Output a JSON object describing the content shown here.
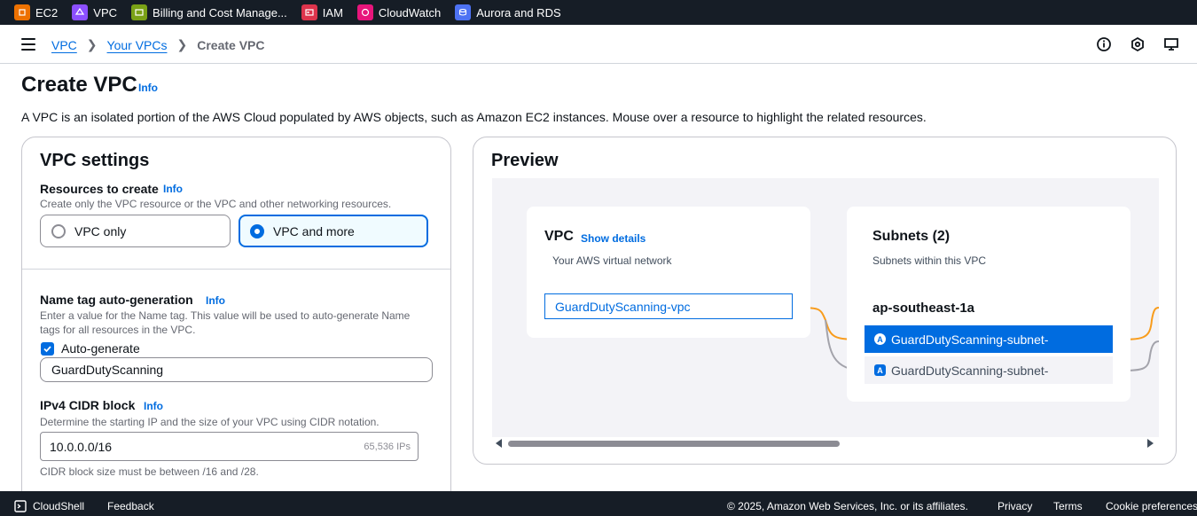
{
  "favorites": [
    {
      "label": "EC2",
      "color": "#ed7100"
    },
    {
      "label": "VPC",
      "color": "#8c4fff"
    },
    {
      "label": "Billing and Cost Manage...",
      "color": "#7aa116"
    },
    {
      "label": "IAM",
      "color": "#dd344c"
    },
    {
      "label": "CloudWatch",
      "color": "#e7157b"
    },
    {
      "label": "Aurora and RDS",
      "color": "#4d72f3"
    }
  ],
  "breadcrumb": {
    "vpc": "VPC",
    "your_vpcs": "Your VPCs",
    "current": "Create VPC"
  },
  "page": {
    "title": "Create VPC",
    "info": "Info",
    "description": "A VPC is an isolated portion of the AWS Cloud populated by AWS objects, such as Amazon EC2 instances. Mouse over a resource to highlight the related resources."
  },
  "settings": {
    "heading": "VPC settings",
    "resources": {
      "label": "Resources to create",
      "info": "Info",
      "description": "Create only the VPC resource or the VPC and other networking resources.",
      "option_vpc_only": "VPC only",
      "option_vpc_more": "VPC and more"
    },
    "name_tag": {
      "label": "Name tag auto-generation",
      "info": "Info",
      "description_line1": "Enter a value for the Name tag. This value will be used to auto-generate Name",
      "description_line2": "tags for all resources in the VPC.",
      "checkbox_label": "Auto-generate",
      "value": "GuardDutyScanning"
    },
    "cidr": {
      "label": "IPv4 CIDR block",
      "info": "Info",
      "description": "Determine the starting IP and the size of your VPC using CIDR notation.",
      "value": "10.0.0.0/16",
      "suffix": "65,536 IPs",
      "constraint": "CIDR block size must be between /16 and /28."
    }
  },
  "preview": {
    "heading": "Preview",
    "vpc": {
      "title": "VPC",
      "show_details": "Show details",
      "subtitle": "Your AWS virtual network",
      "name": "GuardDutyScanning-vpc"
    },
    "subnets": {
      "title": "Subnets (2)",
      "subtitle": "Subnets within this VPC",
      "az": "ap-southeast-1a",
      "badge": "A",
      "items": [
        "GuardDutyScanning-subnet-",
        "GuardDutyScanning-subnet-"
      ]
    },
    "colors": {
      "active_line": "#f89c1c",
      "inactive_line": "#a3a3ab",
      "accent": "#006ce0"
    }
  },
  "footer": {
    "cloudshell": "CloudShell",
    "feedback": "Feedback",
    "copyright": "© 2025, Amazon Web Services, Inc. or its affiliates.",
    "privacy": "Privacy",
    "terms": "Terms",
    "cookies": "Cookie preferences"
  }
}
